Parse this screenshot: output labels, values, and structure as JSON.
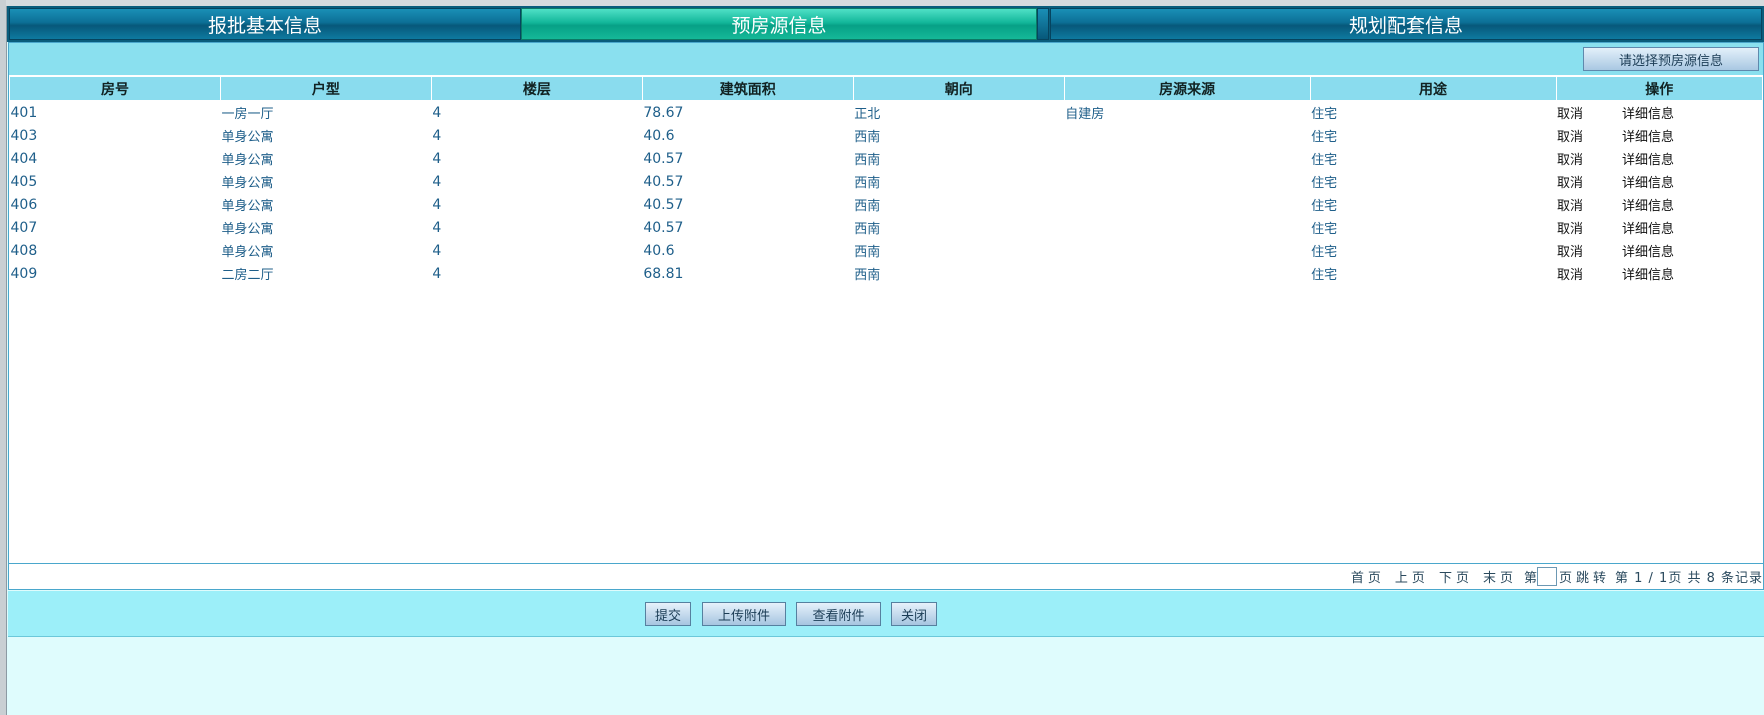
{
  "tabs": [
    "报批基本信息",
    "预房源信息",
    "规划配套信息"
  ],
  "toolbar": {
    "select_button": "请选择预房源信息"
  },
  "table": {
    "headers": [
      "房号",
      "户型",
      "楼层",
      "建筑面积",
      "朝向",
      "房源来源",
      "用途",
      "操作"
    ],
    "rows": [
      {
        "room": "401",
        "layout": "一房一厅",
        "floor": "4",
        "area": "78.67",
        "orientation": "正北",
        "source": "自建房",
        "usage": "住宅",
        "cancel": "取消",
        "detail": "详细信息"
      },
      {
        "room": "403",
        "layout": "单身公寓",
        "floor": "4",
        "area": "40.6",
        "orientation": "西南",
        "source": "",
        "usage": "住宅",
        "cancel": "取消",
        "detail": "详细信息"
      },
      {
        "room": "404",
        "layout": "单身公寓",
        "floor": "4",
        "area": "40.57",
        "orientation": "西南",
        "source": "",
        "usage": "住宅",
        "cancel": "取消",
        "detail": "详细信息"
      },
      {
        "room": "405",
        "layout": "单身公寓",
        "floor": "4",
        "area": "40.57",
        "orientation": "西南",
        "source": "",
        "usage": "住宅",
        "cancel": "取消",
        "detail": "详细信息"
      },
      {
        "room": "406",
        "layout": "单身公寓",
        "floor": "4",
        "area": "40.57",
        "orientation": "西南",
        "source": "",
        "usage": "住宅",
        "cancel": "取消",
        "detail": "详细信息"
      },
      {
        "room": "407",
        "layout": "单身公寓",
        "floor": "4",
        "area": "40.57",
        "orientation": "西南",
        "source": "",
        "usage": "住宅",
        "cancel": "取消",
        "detail": "详细信息"
      },
      {
        "room": "408",
        "layout": "单身公寓",
        "floor": "4",
        "area": "40.6",
        "orientation": "西南",
        "source": "",
        "usage": "住宅",
        "cancel": "取消",
        "detail": "详细信息"
      },
      {
        "room": "409",
        "layout": "二房二厅",
        "floor": "4",
        "area": "68.81",
        "orientation": "西南",
        "source": "",
        "usage": "住宅",
        "cancel": "取消",
        "detail": "详细信息"
      }
    ]
  },
  "pager": {
    "first": "首页",
    "prev": "上页",
    "next": "下页",
    "last": "末页",
    "goto_prefix": "第",
    "goto_suffix": "页跳转",
    "status": "第 1 / 1页 共 8 条记录"
  },
  "buttons": {
    "submit": "提交",
    "upload": "上传附件",
    "view": "查看附件",
    "close": "关闭"
  }
}
